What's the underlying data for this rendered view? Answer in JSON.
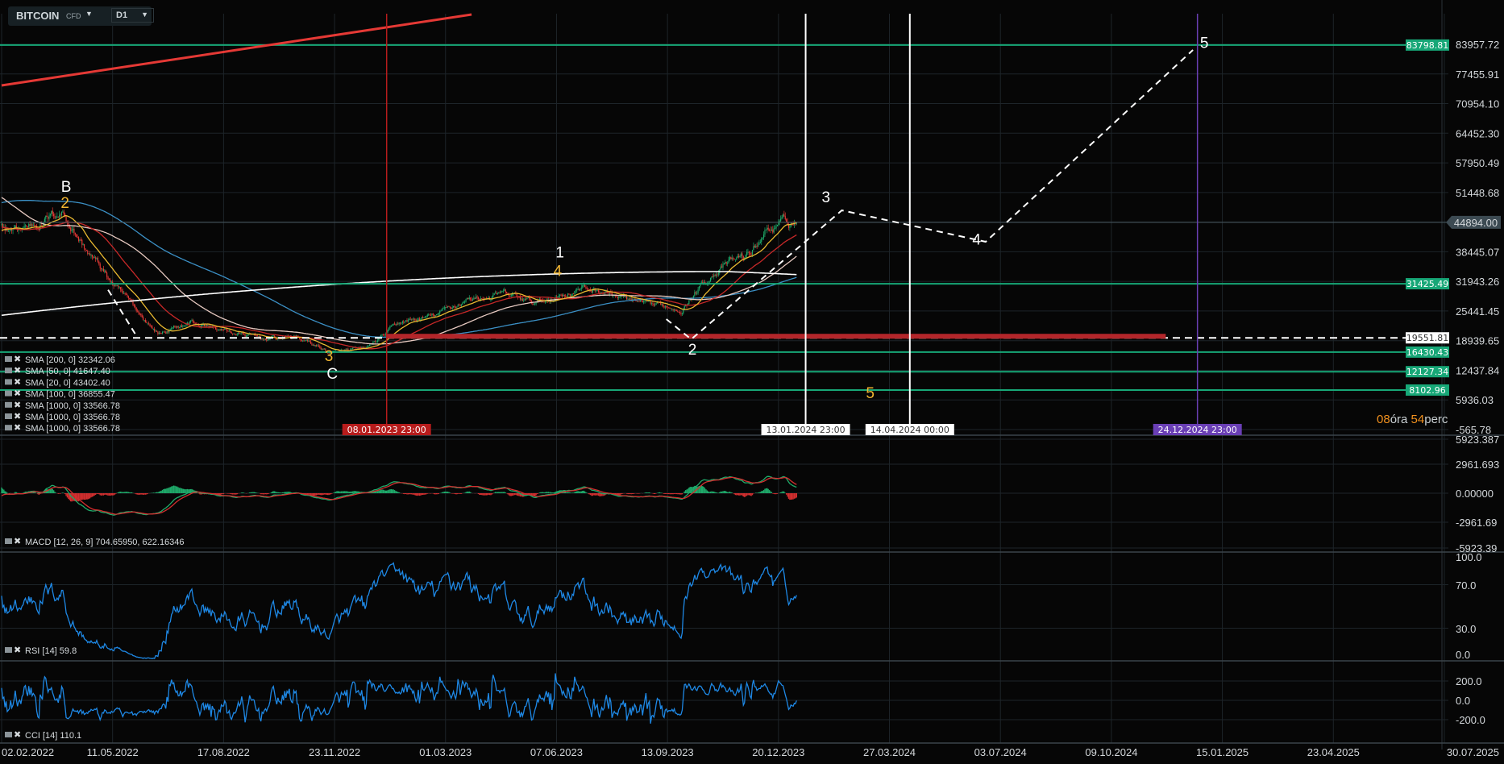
{
  "header": {
    "symbol": "BITCOIN",
    "symbol_type": "CFD",
    "timeframe": "D1",
    "caret": "▼"
  },
  "timer": {
    "hours": "08",
    "hours_unit": "óra",
    "minutes": "54",
    "minutes_unit": "perc"
  },
  "colors": {
    "background": "#060606",
    "grid": "#1d2429",
    "level": "#17a777",
    "trend": "#e53935",
    "sma200": "#3b8fc4",
    "sma50": "#c62828",
    "sma20": "#e8b830",
    "sma100": "#e6c9c0",
    "sma1000": "#ffffff",
    "macd_line": "#1faa6a",
    "macd_signal": "#d32f2f",
    "hist_pos": "#1faa6a",
    "hist_neg": "#d32f2f",
    "rsi": "#1e88e5",
    "cci": "#1e88e5",
    "bull": "#1faa6a",
    "bear": "#e53935",
    "purple": "#6a3fb5"
  },
  "legend": [
    {
      "label": "SMA [200,  0] 32342.06"
    },
    {
      "label": "SMA [50,  0] 41647.40"
    },
    {
      "label": "SMA [20,  0] 43402.40"
    },
    {
      "label": "SMA [100,  0] 36855.47"
    },
    {
      "label": "SMA [1000,  0] 33566.78"
    },
    {
      "label": "SMA [1000,  0] 33566.78"
    },
    {
      "label": "SMA [1000,  0] 33566.78"
    }
  ],
  "panels": {
    "macd": {
      "label": "MACD [12,  26,  9] 704.65950,   622.16346",
      "ticks": [
        "5923.387",
        "2961.693",
        "0.00000",
        "-2961.69",
        "-5923.39"
      ]
    },
    "rsi": {
      "label": "RSI [14]  59.8",
      "ticks": [
        "100.0",
        "70.0",
        "30.0",
        "0.0"
      ]
    },
    "cci": {
      "label": "CCI [14]  110.1",
      "ticks": [
        "200.0",
        "0.0",
        "-200.0"
      ]
    }
  },
  "chart_data": {
    "type": "candlestick",
    "instrument": "BITCOIN CFD",
    "timeframe": "D1",
    "price_ticks": [
      "83957.72",
      "77455.91",
      "70954.10",
      "64452.30",
      "57950.49",
      "51448.68",
      "44894.00",
      "38445.07",
      "31943.26",
      "25441.45",
      "18939.65",
      "12437.84",
      "5936.03",
      "-565.78"
    ],
    "ylim": [
      -565.78,
      83957.72
    ],
    "x_ticks": [
      "02.02.2022",
      "11.05.2022",
      "17.08.2022",
      "23.11.2022",
      "01.03.2023",
      "07.06.2023",
      "13.09.2023",
      "20.12.2023",
      "27.03.2024",
      "03.07.2024",
      "09.10.2024",
      "15.01.2025",
      "23.04.2025",
      "30.07.2025"
    ],
    "current_price": "44894.00",
    "approx_monthly_close": [
      {
        "date": "2022-02-15",
        "price": 43000
      },
      {
        "date": "2022-03-28",
        "price": 47500
      },
      {
        "date": "2022-04-15",
        "price": 40000
      },
      {
        "date": "2022-05-15",
        "price": 30000
      },
      {
        "date": "2022-06-20",
        "price": 20500
      },
      {
        "date": "2022-07-20",
        "price": 23000
      },
      {
        "date": "2022-08-20",
        "price": 21000
      },
      {
        "date": "2022-09-20",
        "price": 19300
      },
      {
        "date": "2022-10-20",
        "price": 19800
      },
      {
        "date": "2022-11-20",
        "price": 16300
      },
      {
        "date": "2022-12-20",
        "price": 16800
      },
      {
        "date": "2023-01-20",
        "price": 22800
      },
      {
        "date": "2023-02-20",
        "price": 24300
      },
      {
        "date": "2023-03-20",
        "price": 28000
      },
      {
        "date": "2023-04-20",
        "price": 29000
      },
      {
        "date": "2023-05-20",
        "price": 27000
      },
      {
        "date": "2023-06-25",
        "price": 30500
      },
      {
        "date": "2023-07-20",
        "price": 29800
      },
      {
        "date": "2023-08-25",
        "price": 26100
      },
      {
        "date": "2023-09-25",
        "price": 26300
      },
      {
        "date": "2023-10-25",
        "price": 34500
      },
      {
        "date": "2023-11-25",
        "price": 37800
      },
      {
        "date": "2023-12-10",
        "price": 43500
      },
      {
        "date": "2024-01-05",
        "price": 44894
      }
    ],
    "levels": [
      {
        "price": 83798.81,
        "label": "83798.81",
        "style": "green"
      },
      {
        "price": 31425.49,
        "label": "31425.49",
        "style": "green"
      },
      {
        "price": 19551.81,
        "label": "19551.81",
        "style": "white-dashed"
      },
      {
        "price": 16430.43,
        "label": "16430.43",
        "style": "green"
      },
      {
        "price": 12127.34,
        "label": "12127.34",
        "style": "green"
      },
      {
        "price": 8102.96,
        "label": "8102.96",
        "style": "green"
      }
    ],
    "red_zone": {
      "price": 19551.81,
      "from": "2023-01-08",
      "to": "2024-11-26"
    },
    "trend_line": {
      "from": {
        "date": "2022-02-02",
        "price": 74934
      },
      "to": {
        "date": "2023-03-24",
        "price": 90496
      }
    },
    "vertical_lines": [
      {
        "date": "2023-01-08",
        "label": "08.01.2023 23:00",
        "style": "red"
      },
      {
        "date": "2024-01-13",
        "label": "13.01.2024 23:00",
        "style": "white"
      },
      {
        "date": "2024-04-14",
        "label": "14.04.2024 00:00",
        "style": "white"
      },
      {
        "date": "2024-12-24",
        "label": "24.12.2024 23:00",
        "style": "purple"
      }
    ],
    "projection": [
      {
        "date": "2023-09-12",
        "price": 23660
      },
      {
        "date": "2023-10-04",
        "price": 19240
      },
      {
        "date": "2024-02-14",
        "price": 47530
      },
      {
        "date": "2024-06-20",
        "price": 40630
      },
      {
        "date": "2024-12-20",
        "price": 82720
      }
    ],
    "projection_early": [
      {
        "date": "2022-05-07",
        "price": 30100
      },
      {
        "date": "2022-06-02",
        "price": 19600
      }
    ],
    "wave_labels": [
      {
        "text": "B",
        "color": "white",
        "date": "2022-03-31",
        "price": 51600
      },
      {
        "text": "2",
        "color": "yellow",
        "date": "2022-03-30",
        "price": 48100
      },
      {
        "text": "3",
        "color": "yellow",
        "date": "2022-11-18",
        "price": 14500
      },
      {
        "text": "C",
        "color": "white",
        "date": "2022-11-21",
        "price": 10600
      },
      {
        "text": "1",
        "color": "white",
        "date": "2023-06-10",
        "price": 37200
      },
      {
        "text": "4",
        "color": "yellow",
        "date": "2023-06-08",
        "price": 33100
      },
      {
        "text": "2",
        "color": "white",
        "date": "2023-10-05",
        "price": 15900
      },
      {
        "text": "3",
        "color": "white",
        "date": "2024-01-31",
        "price": 49300
      },
      {
        "text": "4",
        "color": "white",
        "date": "2024-06-12",
        "price": 40000
      },
      {
        "text": "5",
        "color": "white",
        "date": "2024-12-30",
        "price": 83200
      },
      {
        "text": "5",
        "color": "yellow",
        "date": "2024-03-10",
        "price": 6300
      }
    ]
  }
}
